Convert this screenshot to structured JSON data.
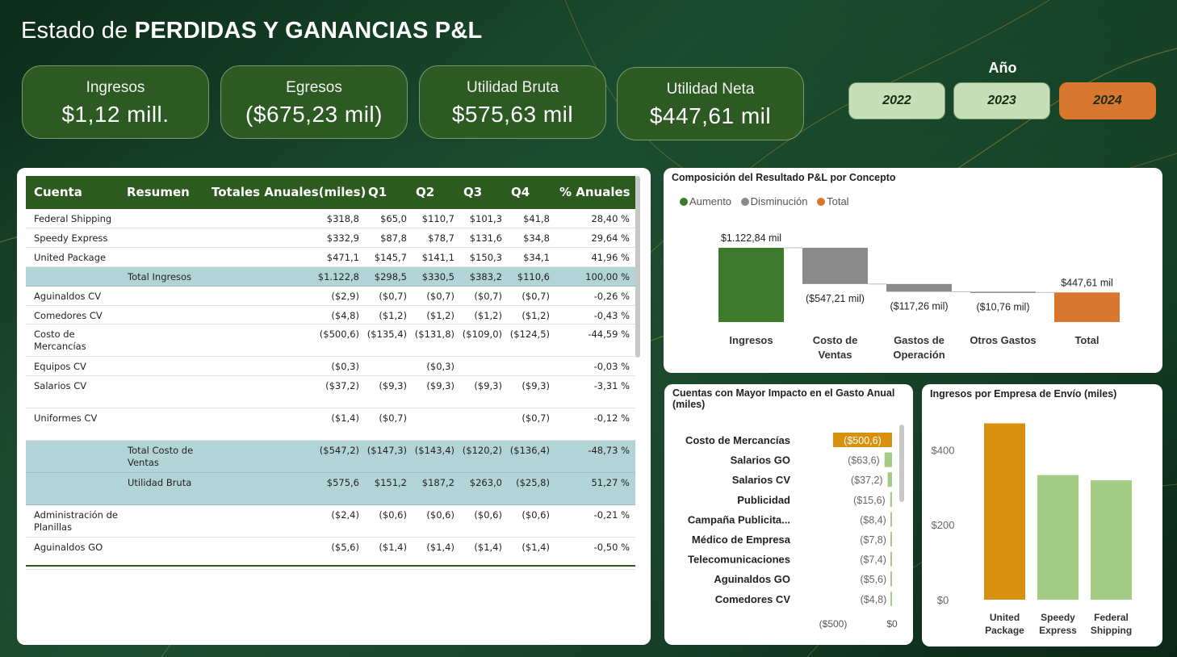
{
  "header": {
    "title_light": "Estado de ",
    "title_bold": "PERDIDAS Y GANANCIAS P&L"
  },
  "kpis": [
    {
      "label": "Ingresos",
      "value": "$1,12 mill."
    },
    {
      "label": "Egresos",
      "value": "($675,23 mil)"
    },
    {
      "label": "Utilidad Bruta",
      "value": "$575,63 mil"
    },
    {
      "label": "Utilidad Neta",
      "value": "$447,61 mil"
    }
  ],
  "year_filter": {
    "title": "Año",
    "options": [
      "2022",
      "2023",
      "2024"
    ],
    "selected": "2024"
  },
  "table": {
    "columns": [
      "Cuenta",
      "Resumen",
      "Totales Anuales(miles)",
      "Q1",
      "Q2",
      "Q3",
      "Q4",
      "% Anuales"
    ],
    "rows": [
      {
        "cuenta": "Federal Shipping",
        "resumen": "",
        "total": "$318,8",
        "q1": "$65,0",
        "q2": "$110,7",
        "q3": "$101,3",
        "q4": "$41,8",
        "pct": "28,40 %"
      },
      {
        "cuenta": "Speedy Express",
        "resumen": "",
        "total": "$332,9",
        "q1": "$87,8",
        "q2": "$78,7",
        "q3": "$131,6",
        "q4": "$34,8",
        "pct": "29,64 %"
      },
      {
        "cuenta": "United Package",
        "resumen": "",
        "total": "$471,1",
        "q1": "$145,7",
        "q2": "$141,1",
        "q3": "$150,3",
        "q4": "$34,1",
        "pct": "41,96 %"
      },
      {
        "cuenta": "",
        "resumen": "Total Ingresos",
        "total": "$1.122,8",
        "q1": "$298,5",
        "q2": "$330,5",
        "q3": "$383,2",
        "q4": "$110,6",
        "pct": "100,00 %",
        "highlight": true
      },
      {
        "cuenta": "Aguinaldos CV",
        "resumen": "",
        "total": "($2,9)",
        "q1": "($0,7)",
        "q2": "($0,7)",
        "q3": "($0,7)",
        "q4": "($0,7)",
        "pct": "-0,26 %"
      },
      {
        "cuenta": "Comedores CV",
        "resumen": "",
        "total": "($4,8)",
        "q1": "($1,2)",
        "q2": "($1,2)",
        "q3": "($1,2)",
        "q4": "($1,2)",
        "pct": "-0,43 %"
      },
      {
        "cuenta": "Costo de\nMercancías",
        "resumen": "",
        "total": "($500,6)",
        "q1": "($135,4)",
        "q2": "($131,8)",
        "q3": "($109,0)",
        "q4": "($124,5)",
        "pct": "-44,59 %"
      },
      {
        "cuenta": "Equipos CV",
        "resumen": "",
        "total": "($0,3)",
        "q1": "",
        "q2": "($0,3)",
        "q3": "",
        "q4": "",
        "pct": "-0,03 %"
      },
      {
        "cuenta": "Salarios CV",
        "resumen": "",
        "total": "($37,2)",
        "q1": "($9,3)",
        "q2": "($9,3)",
        "q3": "($9,3)",
        "q4": "($9,3)",
        "pct": "-3,31 %"
      },
      {
        "cuenta": "Uniformes CV",
        "resumen": "",
        "total": "($1,4)",
        "q1": "($0,7)",
        "q2": "",
        "q3": "",
        "q4": "($0,7)",
        "pct": "-0,12 %"
      },
      {
        "cuenta": "",
        "resumen": "Total Costo de\nVentas",
        "total": "($547,2)",
        "q1": "($147,3)",
        "q2": "($143,4)",
        "q3": "($120,2)",
        "q4": "($136,4)",
        "pct": "-48,73 %",
        "highlight": true
      },
      {
        "cuenta": "",
        "resumen": "Utilidad Bruta",
        "total": "$575,6",
        "q1": "$151,2",
        "q2": "$187,2",
        "q3": "$263,0",
        "q4": "($25,8)",
        "pct": "51,27 %",
        "highlight": true
      },
      {
        "cuenta": "Administración de\nPlanillas",
        "resumen": "",
        "total": "($2,4)",
        "q1": "($0,6)",
        "q2": "($0,6)",
        "q3": "($0,6)",
        "q4": "($0,6)",
        "pct": "-0,21 %"
      },
      {
        "cuenta": "Aguinaldos GO",
        "resumen": "",
        "total": "($5,6)",
        "q1": "($1,4)",
        "q2": "($1,4)",
        "q3": "($1,4)",
        "q4": "($1,4)",
        "pct": "-0,50 %"
      }
    ]
  },
  "chart_data": [
    {
      "type": "bar",
      "subtype": "waterfall",
      "title": "Composición del Resultado P&L por Concepto",
      "legend": [
        {
          "name": "Aumento",
          "color": "#3e7a2b"
        },
        {
          "name": "Disminución",
          "color": "#8a8a8a"
        },
        {
          "name": "Total",
          "color": "#d9772e"
        }
      ],
      "categories": [
        "Ingresos",
        "Costo de\nVentas",
        "Gastos de\nOperación",
        "Otros Gastos",
        "Total"
      ],
      "values": [
        1122.84,
        -547.21,
        -117.26,
        -10.76,
        447.61
      ],
      "kinds": [
        "Aumento",
        "Disminución",
        "Disminución",
        "Disminución",
        "Total"
      ],
      "data_labels": [
        "$1.122,84 mil",
        "($547,21 mil)",
        "($117,26 mil)",
        "($10,76 mil)",
        "$447,61 mil"
      ]
    },
    {
      "type": "bar",
      "orientation": "horizontal",
      "title": "Cuentas con Mayor Impacto en el Gasto Anual\n(miles)",
      "categories": [
        "Costo de Mercancías",
        "Salarios GO",
        "Salarios CV",
        "Publicidad",
        "Campaña Publicita...",
        "Médico de Empresa",
        "Telecomunicaciones",
        "Aguinaldos GO",
        "Comedores CV"
      ],
      "values": [
        -500.6,
        -63.6,
        -37.2,
        -15.6,
        -8.4,
        -7.8,
        -7.4,
        -5.6,
        -4.8
      ],
      "data_labels": [
        "($500,6)",
        "($63,6)",
        "($37,2)",
        "($15,6)",
        "($8,4)",
        "($7,8)",
        "($7,4)",
        "($5,6)",
        "($4,8)"
      ],
      "xlim": [
        -500,
        0
      ],
      "x_ticks": [
        "($500)",
        "$0"
      ],
      "colors": {
        "highlight": "#d8900f",
        "default": "#a3cc84"
      }
    },
    {
      "type": "bar",
      "title": "Ingresos por Empresa de Envío (miles)",
      "categories": [
        "United\nPackage",
        "Speedy\nExpress",
        "Federal\nShipping"
      ],
      "values": [
        471.1,
        332.9,
        318.8
      ],
      "ylim": [
        0,
        470
      ],
      "y_ticks": [
        {
          "value": 0,
          "label": "$0"
        },
        {
          "value": 200,
          "label": "$200"
        },
        {
          "value": 400,
          "label": "$400"
        }
      ],
      "colors": [
        "#d8900f",
        "#a3cc84",
        "#a3cc84"
      ]
    }
  ]
}
